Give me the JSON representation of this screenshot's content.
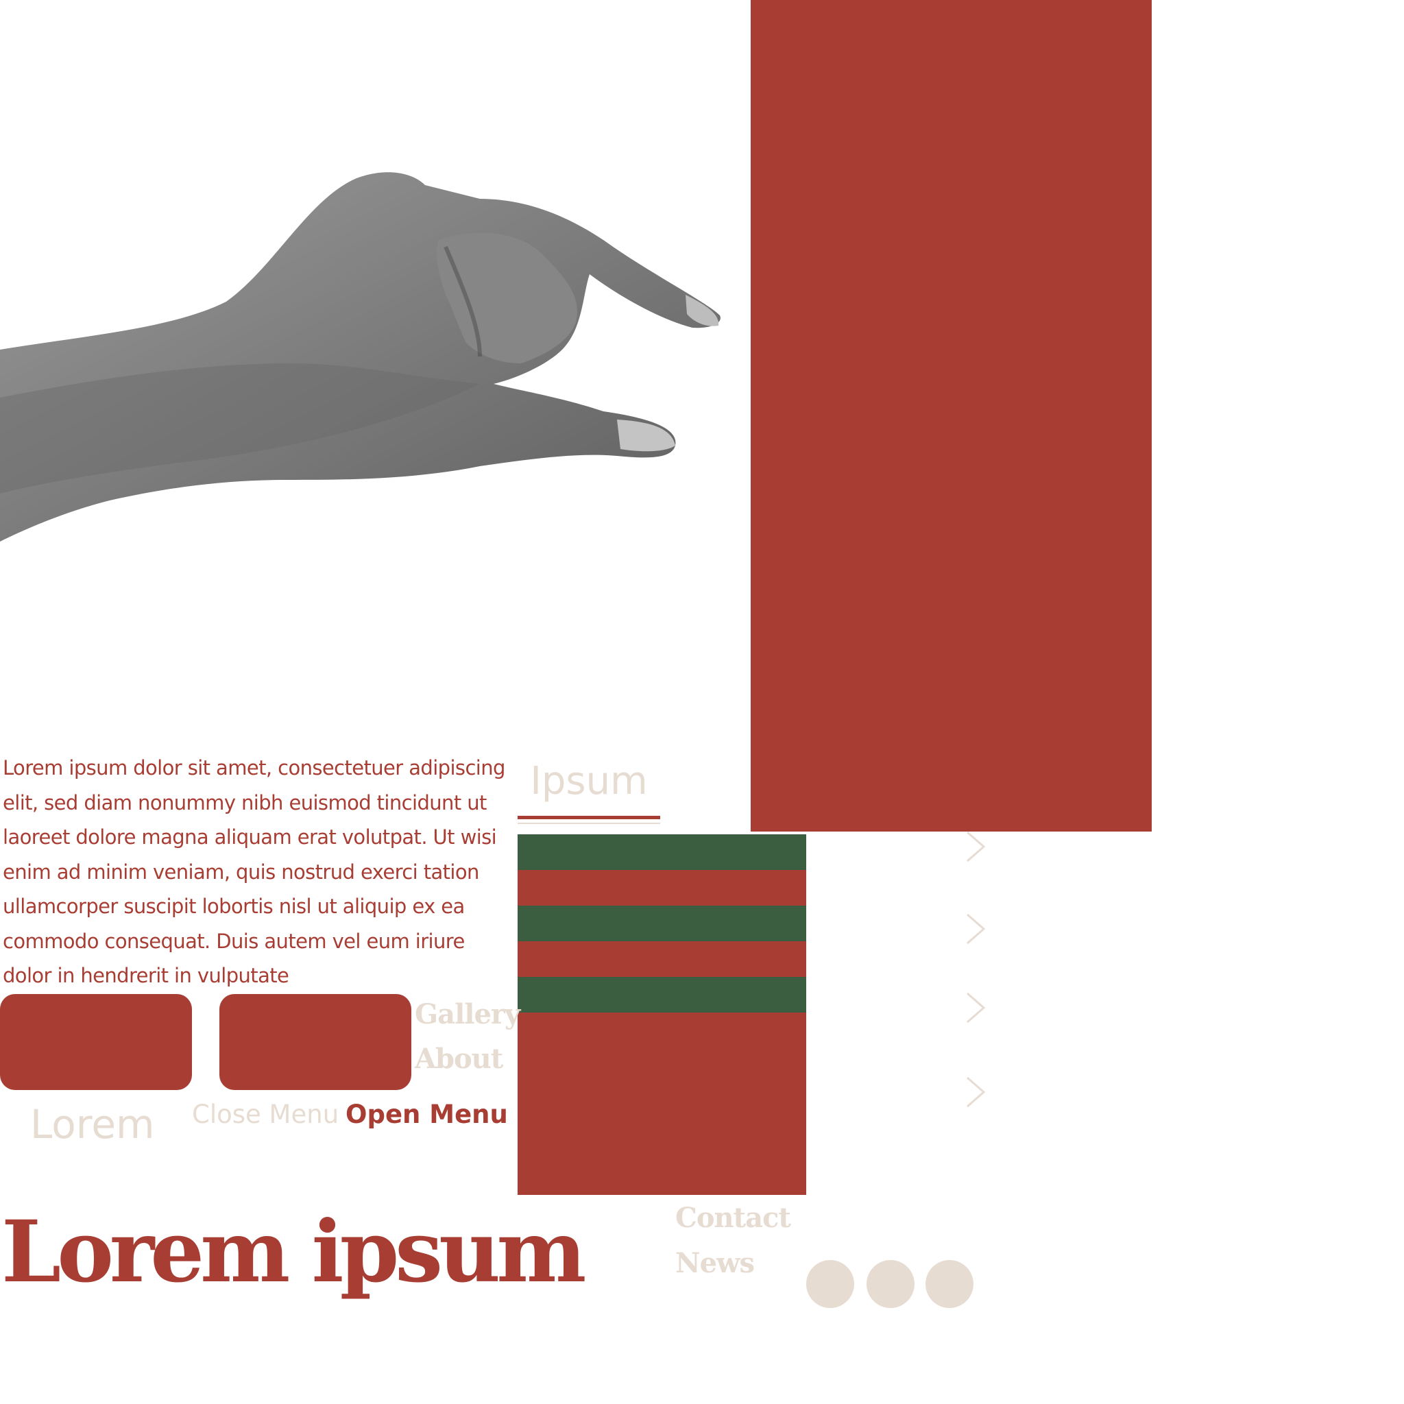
{
  "colors": {
    "red": "#A83D33",
    "green": "#3B5E41",
    "beige": "#E7DCD2",
    "white": "#FFFFFF"
  },
  "intro": {
    "paragraph": "Lorem ipsum dolor sit amet, consectetuer adipiscing elit, sed diam nonummy nibh euismod tincidunt ut laoreet dolore magna aliquam erat volutpat. Ut wisi enim ad minim veniam, quis nostrud exerci tation ullamcorper suscipit lobortis nisl ut aliquip ex ea commodo consequat. Duis autem vel eum iriure dolor in hendrerit in vulputate"
  },
  "tab": {
    "label": "Ipsum"
  },
  "nav": {
    "gallery": "Gallery",
    "about": "About",
    "contact": "Contact",
    "news": "News"
  },
  "menu": {
    "lorem": "Lorem",
    "close": "Close Menu",
    "open": "Open Menu"
  },
  "headline": "Lorem ipsum",
  "icons": {
    "hand": "hand-pinch-photo",
    "chevron": "chevron-right-icon"
  }
}
